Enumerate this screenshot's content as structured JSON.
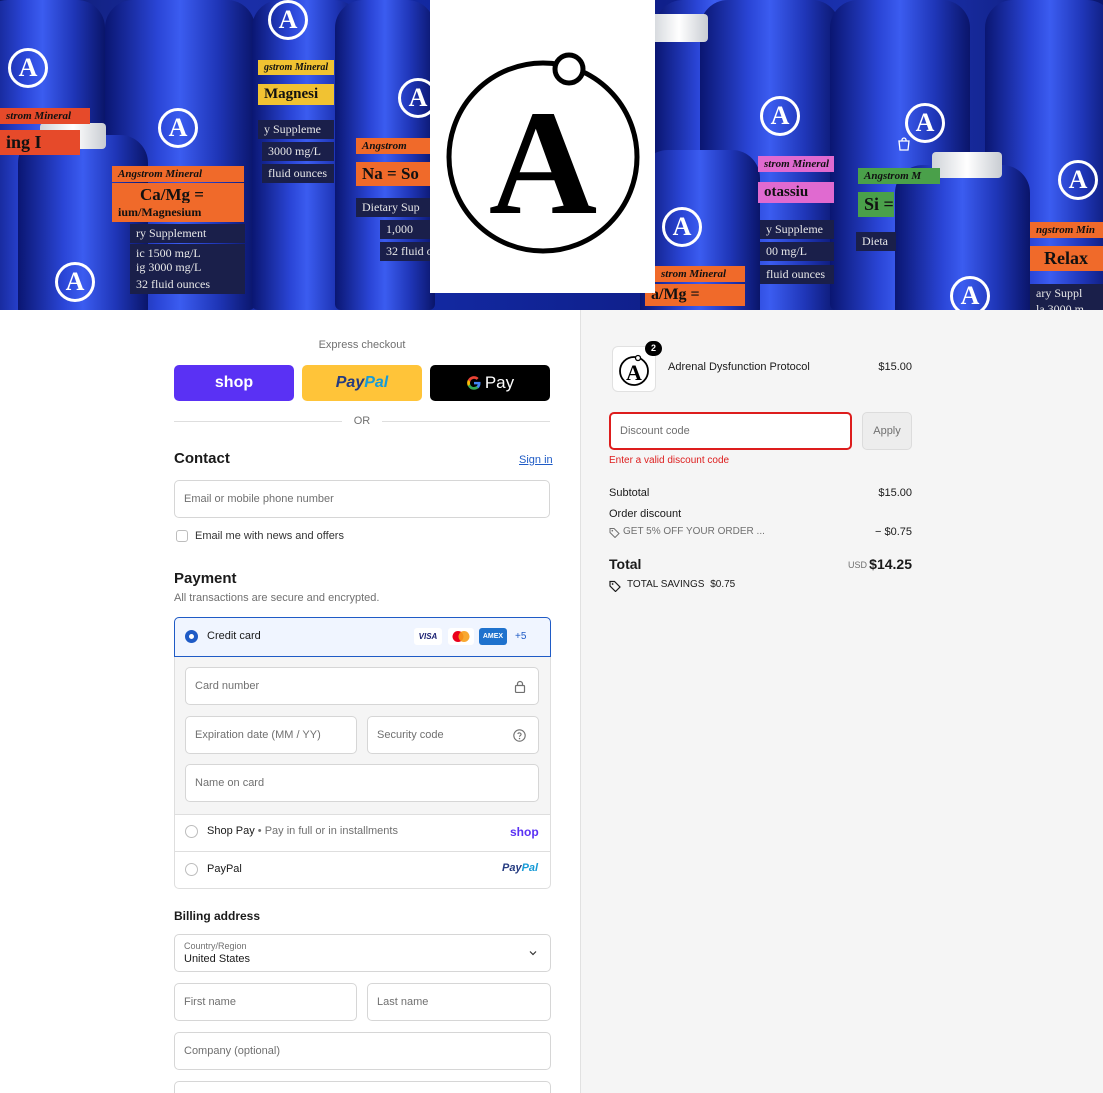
{
  "banner": {
    "bottle_labels": [
      "strom Mineral",
      "ing I",
      "Angstrom Mineral",
      "Ca/Mg =",
      "ium/Magnesium",
      "ry Supplement",
      "ic 1500 mg/L",
      "ig 3000 mg/L",
      "32 fluid ounces",
      "gstrom Mineral",
      "Magnesi",
      "y Suppleme",
      "3000 mg/L",
      "fluid ounces",
      "Angstrom",
      "Na = So",
      "Dietary Sup",
      "1,000",
      "32 fluid o",
      "strom Mineral",
      "otassiu",
      "y Suppleme",
      "00 mg/L",
      "fluid ounces",
      "strom Mineral",
      "a/Mg =",
      "Angstrom M",
      "Si =",
      "Dieta",
      "ngstrom Min",
      "Relax",
      "ary Suppl",
      "la 3000 m"
    ],
    "logo_letter": "A"
  },
  "express": {
    "title": "Express checkout",
    "shop_label": "shop",
    "paypal_label_a": "Pay",
    "paypal_label_b": "Pal",
    "gpay_label": "Pay",
    "or_label": "OR"
  },
  "contact": {
    "heading": "Contact",
    "signin": "Sign in",
    "email_placeholder": "Email or mobile phone number",
    "newsletter_label": "Email me with news and offers"
  },
  "payment": {
    "heading": "Payment",
    "subtext": "All transactions are secure and encrypted.",
    "credit_card_label": "Credit card",
    "card_brands": [
      "VISA",
      "AMEX"
    ],
    "more_brands": "+5",
    "card_number_ph": "Card number",
    "expiration_ph": "Expiration date (MM / YY)",
    "security_ph": "Security code",
    "name_ph": "Name on card",
    "shop_pay_label": "Shop Pay",
    "shop_pay_sep": "•",
    "shop_pay_desc": "Pay in full or in installments",
    "shop_logo": "shop",
    "paypal_label": "PayPal",
    "paypal_logo_a": "Pay",
    "paypal_logo_b": "Pal"
  },
  "billing": {
    "heading": "Billing address",
    "country_label": "Country/Region",
    "country_value": "United States",
    "first_ph": "First name",
    "last_ph": "Last name",
    "company_ph": "Company (optional)"
  },
  "summary": {
    "item_qty": "2",
    "item_name": "Adrenal Dysfunction Protocol",
    "item_price": "$15.00",
    "item_logo_letter": "A",
    "discount_ph": "Discount code",
    "apply_label": "Apply",
    "discount_error": "Enter a valid discount code",
    "subtotal_label": "Subtotal",
    "subtotal_value": "$15.00",
    "order_discount_label": "Order discount",
    "discount_code_text": "GET 5% OFF YOUR ORDER ...",
    "discount_value": "− $0.75",
    "total_label": "Total",
    "currency": "USD",
    "total_value": "$14.25",
    "savings_label": "TOTAL SAVINGS",
    "savings_value": "$0.75"
  },
  "colors": {
    "shop_purple": "#5a31f4",
    "paypal_yellow": "#ffc439",
    "paypal_dark_blue": "#253b80",
    "paypal_light_blue": "#179bd7",
    "accent_blue": "#1f5bc6",
    "error_red": "#dd1d1d"
  }
}
